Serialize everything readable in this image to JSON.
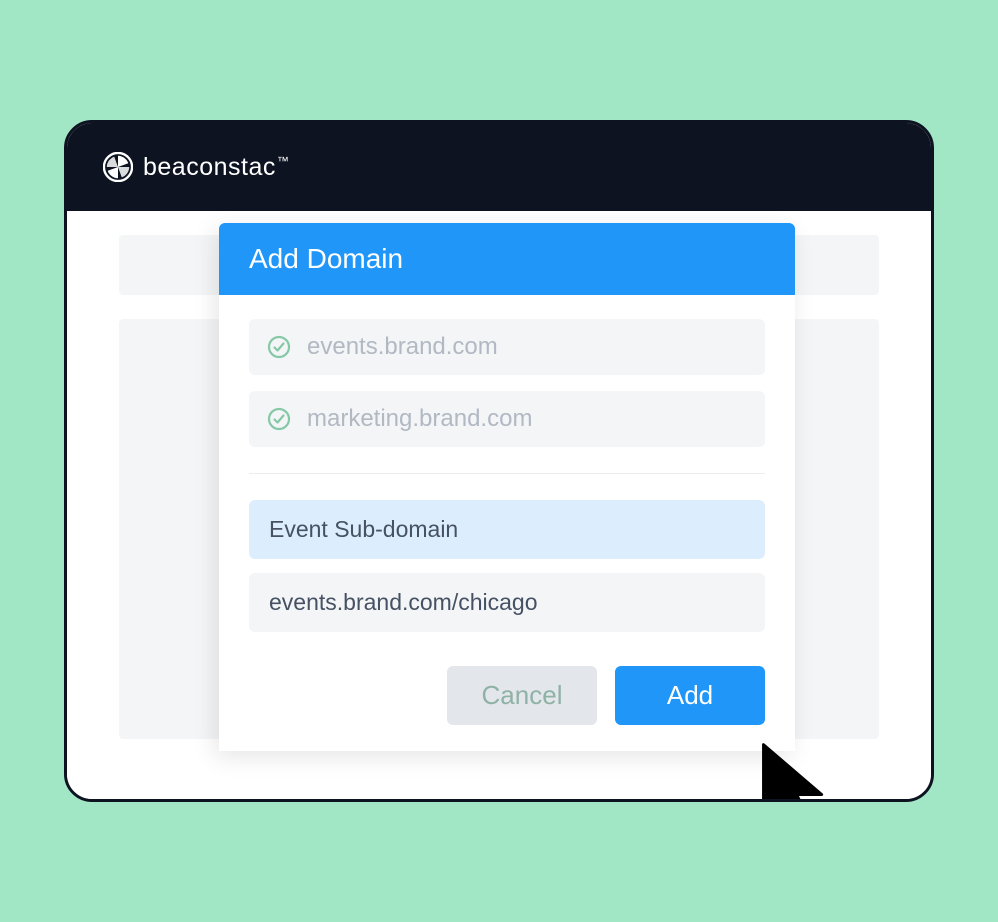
{
  "brand": {
    "name": "beaconstac",
    "trademark": "™"
  },
  "modal": {
    "title": "Add Domain",
    "existing_domains": [
      "events.brand.com",
      "marketing.brand.com"
    ],
    "name_field_value": "Event Sub-domain",
    "url_field_value": "events.brand.com/chicago",
    "cancel_label": "Cancel",
    "add_label": "Add"
  },
  "colors": {
    "primary": "#2196f9",
    "dark": "#0d1320",
    "background": "#a1e6c5",
    "success_check": "#85c8a8"
  }
}
